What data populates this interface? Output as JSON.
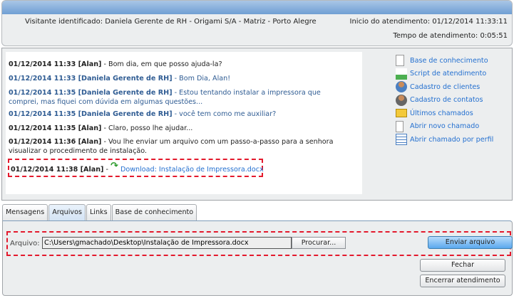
{
  "header": {
    "visitor": "Visitante identificado: Daniela Gerente de RH - Origami S/A - Matriz - Porto Alegre",
    "start": "Inicio do atendimento: 01/12/2014 11:33:11",
    "duration": "Tempo de atendimento: 0:05:51"
  },
  "chat": [
    {
      "meta": "01/12/2014 11:33 [Alan]",
      "text": " - Bom dia, em que posso ajuda-la?",
      "who": "agent"
    },
    {
      "meta": "01/12/2014 11:33 [Daniela Gerente de RH]",
      "text": " - Bom Dia, Alan!",
      "who": "client"
    },
    {
      "meta": "01/12/2014 11:35 [Daniela Gerente de RH]",
      "text": " - Estou tentando instalar a impressora que comprei, mas fiquei com dúvida em algumas questões...",
      "who": "client"
    },
    {
      "meta": "01/12/2014 11:35 [Daniela Gerente de RH]",
      "text": " - você tem como me auxiliar?",
      "who": "client"
    },
    {
      "meta": "01/12/2014 11:35 [Alan]",
      "text": " - Claro, posso lhe ajudar...",
      "who": "agent"
    },
    {
      "meta": "01/12/2014 11:36 [Alan]",
      "text": " - Vou lhe enviar um arquivo com um passo-a-passo para a senhora visualizar o procedimento de instalação.",
      "who": "agent"
    }
  ],
  "download": {
    "meta": "01/12/2014 11:38 [Alan]",
    "sep": " - ",
    "link": "Download: Instalação de Impressora.docx"
  },
  "links": [
    {
      "label": "Base de conhecimento",
      "icon": "document-icon"
    },
    {
      "label": "Script de atendimento",
      "icon": "org-chart-icon"
    },
    {
      "label": "Cadastro de clientes",
      "icon": "user-icon"
    },
    {
      "label": "Cadastro de contatos",
      "icon": "contact-icon"
    },
    {
      "label": "Últimos chamados",
      "icon": "folder-icon"
    },
    {
      "label": "Abrir novo chamado",
      "icon": "new-ticket-icon"
    },
    {
      "label": "Abrir chamado por perfil",
      "icon": "checklist-icon"
    }
  ],
  "tabs": [
    "Mensagens",
    "Arquivos",
    "Links",
    "Base de conhecimento"
  ],
  "active_tab": "Arquivos",
  "files": {
    "label": "Arquivo:",
    "path": "C:\\Users\\gmachado\\Desktop\\Instalação de Impressora.docx",
    "browse": "Procurar...",
    "send": "Enviar arquivo"
  },
  "buttons": {
    "close": "Fechar",
    "end": "Encerrar atendimento"
  }
}
